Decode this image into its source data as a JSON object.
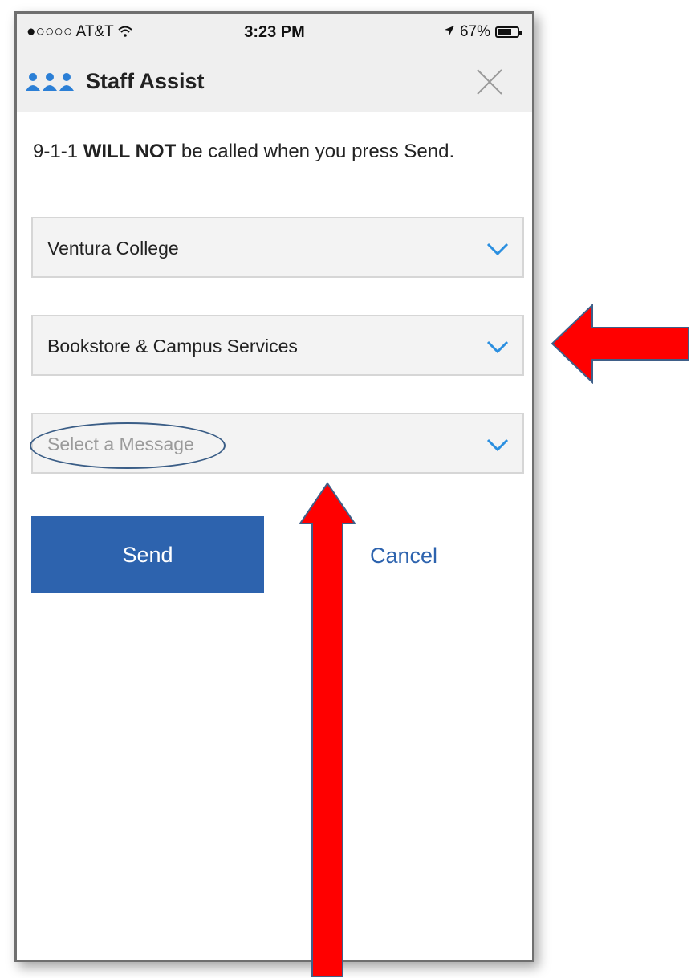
{
  "status_bar": {
    "carrier": "●○○○○ AT&T",
    "wifi_icon": "wifi-icon",
    "time": "3:23 PM",
    "location_icon": "location-arrow-icon",
    "battery_percent": "67%",
    "battery_level": 0.67
  },
  "header": {
    "icon": "staff-group-icon",
    "title": "Staff Assist",
    "close_icon": "close-icon"
  },
  "notice": {
    "prefix": "9-1-1 ",
    "emphasis": "WILL NOT",
    "suffix": " be called when you press Send."
  },
  "selects": {
    "campus": {
      "value": "Ventura College"
    },
    "department": {
      "value": "Bookstore & Campus Services"
    },
    "message": {
      "placeholder": "Select a Message"
    }
  },
  "actions": {
    "send_label": "Send",
    "cancel_label": "Cancel"
  },
  "colors": {
    "accent": "#2d63ae",
    "chevron": "#2b8fe0",
    "annotation_arrow": "#ff0000",
    "annotation_oval": "#3a5d86"
  }
}
